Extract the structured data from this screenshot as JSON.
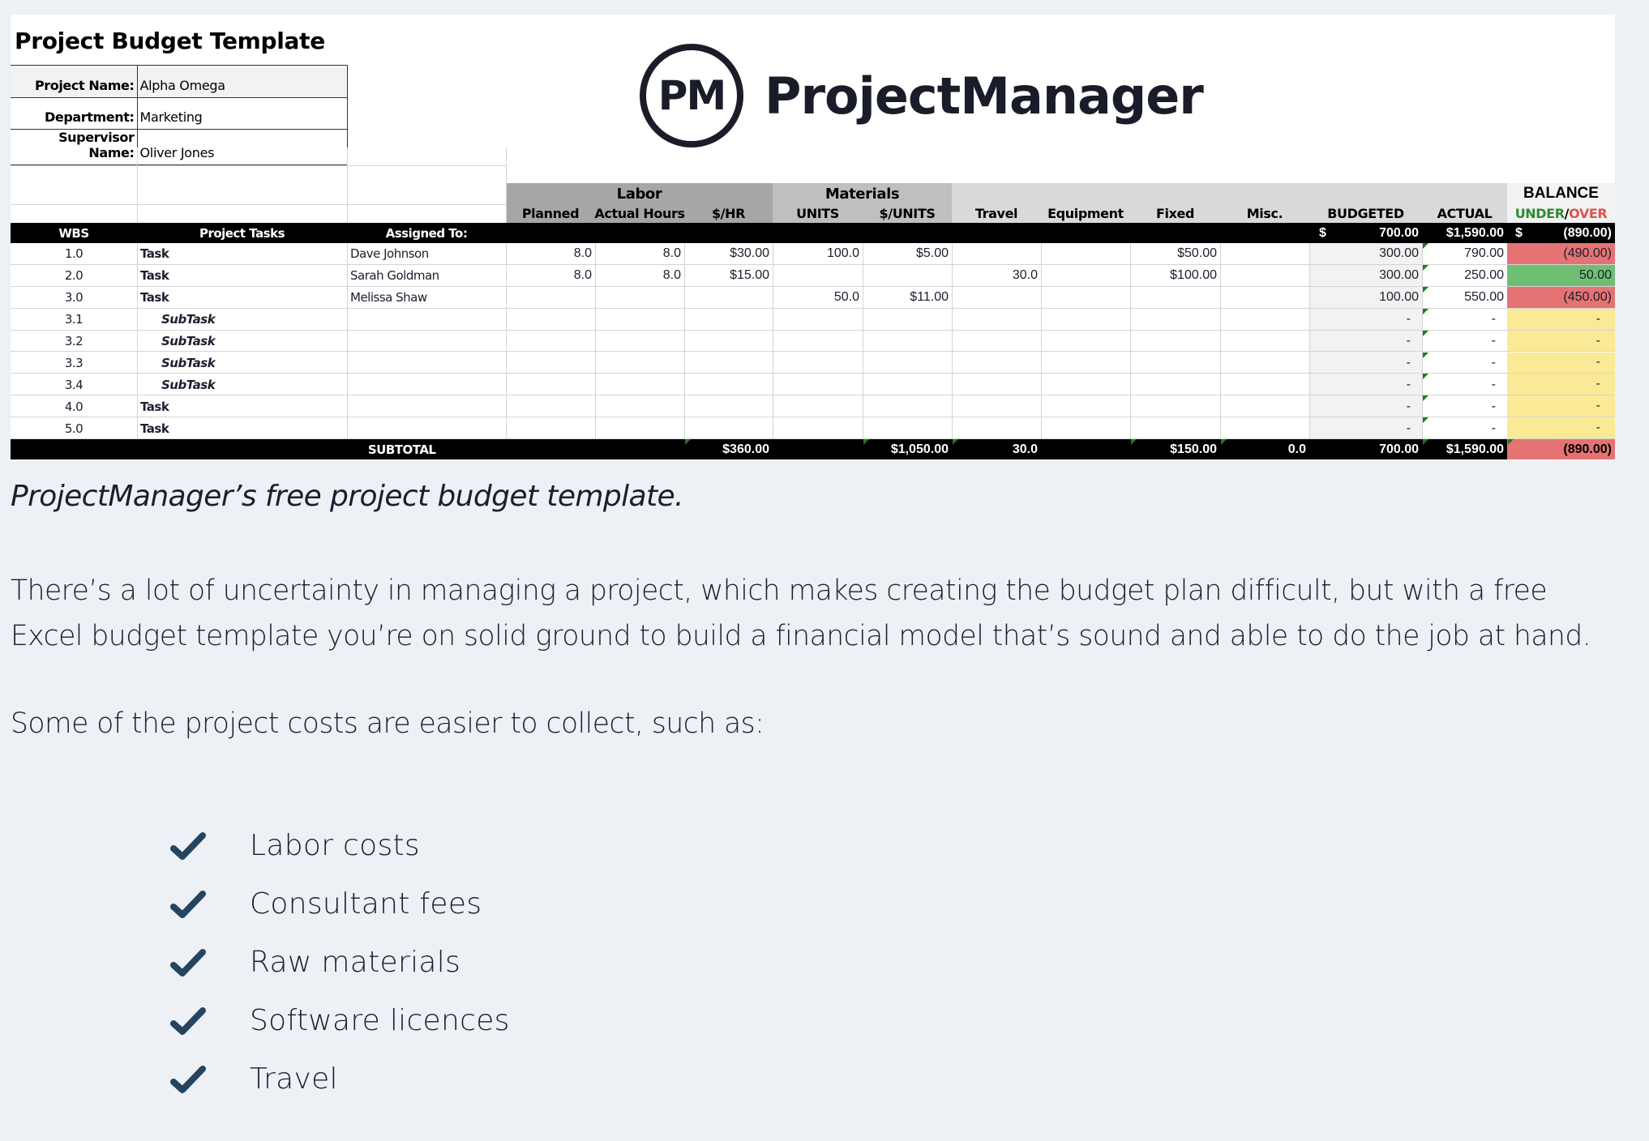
{
  "sheet": {
    "title": "Project Budget Template",
    "info": [
      {
        "label": "Project Name:",
        "value": "Alpha Omega"
      },
      {
        "label": "Department:",
        "value": "Marketing"
      },
      {
        "label": "Supervisor Name:",
        "value": "Oliver Jones"
      }
    ],
    "logo": {
      "mark": "PM",
      "name": "ProjectManager"
    },
    "group_headers": {
      "labor": "Labor",
      "materials": "Materials",
      "balance": "BALANCE",
      "balance_under": "UNDER",
      "balance_slash": "/",
      "balance_over": "OVER"
    },
    "columns": {
      "wbs": "WBS",
      "tasks": "Project Tasks",
      "assigned": "Assigned To:",
      "planned": "Planned",
      "actual_hours": "Actual Hours",
      "rate": "$/HR",
      "units": "UNITS",
      "per_unit": "$/UNITS",
      "travel": "Travel",
      "equipment": "Equipment",
      "fixed": "Fixed",
      "misc": "Misc.",
      "budgeted": "BUDGETED",
      "actual": "ACTUAL"
    },
    "totals_row": {
      "budgeted_symbol": "$",
      "budgeted": "700.00",
      "actual": "$1,590.00",
      "balance_symbol": "$",
      "balance": "(890.00)"
    },
    "rows": [
      {
        "wbs": "1.0",
        "task": "Task",
        "subtask": false,
        "assigned": "Dave Johnson",
        "planned": "8.0",
        "actual_hours": "8.0",
        "rate": "$30.00",
        "units": "100.0",
        "per_unit": "$5.00",
        "travel": "",
        "equipment": "",
        "fixed": "$50.00",
        "misc": "",
        "budgeted": "300.00",
        "actual": "790.00",
        "balance": "(490.00)",
        "status": "over"
      },
      {
        "wbs": "2.0",
        "task": "Task",
        "subtask": false,
        "assigned": "Sarah Goldman",
        "planned": "8.0",
        "actual_hours": "8.0",
        "rate": "$15.00",
        "units": "",
        "per_unit": "",
        "travel": "30.0",
        "equipment": "",
        "fixed": "$100.00",
        "misc": "",
        "budgeted": "300.00",
        "actual": "250.00",
        "balance": "50.00",
        "status": "under"
      },
      {
        "wbs": "3.0",
        "task": "Task",
        "subtask": false,
        "assigned": "Melissa Shaw",
        "planned": "",
        "actual_hours": "",
        "rate": "",
        "units": "50.0",
        "per_unit": "$11.00",
        "travel": "",
        "equipment": "",
        "fixed": "",
        "misc": "",
        "budgeted": "100.00",
        "actual": "550.00",
        "balance": "(450.00)",
        "status": "over"
      },
      {
        "wbs": "3.1",
        "task": "SubTask",
        "subtask": true,
        "assigned": "",
        "planned": "",
        "actual_hours": "",
        "rate": "",
        "units": "",
        "per_unit": "",
        "travel": "",
        "equipment": "",
        "fixed": "",
        "misc": "",
        "budgeted": "-",
        "actual": "-",
        "balance": "-",
        "status": "zero"
      },
      {
        "wbs": "3.2",
        "task": "SubTask",
        "subtask": true,
        "assigned": "",
        "planned": "",
        "actual_hours": "",
        "rate": "",
        "units": "",
        "per_unit": "",
        "travel": "",
        "equipment": "",
        "fixed": "",
        "misc": "",
        "budgeted": "-",
        "actual": "-",
        "balance": "-",
        "status": "zero"
      },
      {
        "wbs": "3.3",
        "task": "SubTask",
        "subtask": true,
        "assigned": "",
        "planned": "",
        "actual_hours": "",
        "rate": "",
        "units": "",
        "per_unit": "",
        "travel": "",
        "equipment": "",
        "fixed": "",
        "misc": "",
        "budgeted": "-",
        "actual": "-",
        "balance": "-",
        "status": "zero"
      },
      {
        "wbs": "3.4",
        "task": "SubTask",
        "subtask": true,
        "assigned": "",
        "planned": "",
        "actual_hours": "",
        "rate": "",
        "units": "",
        "per_unit": "",
        "travel": "",
        "equipment": "",
        "fixed": "",
        "misc": "",
        "budgeted": "-",
        "actual": "-",
        "balance": "-",
        "status": "zero"
      },
      {
        "wbs": "4.0",
        "task": "Task",
        "subtask": false,
        "assigned": "",
        "planned": "",
        "actual_hours": "",
        "rate": "",
        "units": "",
        "per_unit": "",
        "travel": "",
        "equipment": "",
        "fixed": "",
        "misc": "",
        "budgeted": "-",
        "actual": "-",
        "balance": "-",
        "status": "zero"
      },
      {
        "wbs": "5.0",
        "task": "Task",
        "subtask": false,
        "assigned": "",
        "planned": "",
        "actual_hours": "",
        "rate": "",
        "units": "",
        "per_unit": "",
        "travel": "",
        "equipment": "",
        "fixed": "",
        "misc": "",
        "budgeted": "-",
        "actual": "-",
        "balance": "-",
        "status": "zero"
      }
    ],
    "subtotal": {
      "label": "SUBTOTAL",
      "rate": "$360.00",
      "per_unit": "$1,050.00",
      "travel": "30.0",
      "fixed": "$150.00",
      "misc": "0.0",
      "budgeted": "700.00",
      "actual": "$1,590.00",
      "balance": "(890.00)"
    },
    "colors": {
      "over": "#e57373",
      "under": "#6fbf73",
      "zero": "#faea96",
      "under_text": "#2e8b2e",
      "over_text": "#d9534f"
    }
  },
  "article": {
    "caption": "ProjectManager’s free project budget template.",
    "paragraph1_line1": "There’s a lot of uncertainty in managing a project, which makes creating the budget plan difficult, but with a free",
    "paragraph1_line2": "Excel budget template you’re on solid ground to build a financial model that’s sound and able to do the job at hand.",
    "paragraph2": "Some of the project costs are easier to collect, such as:",
    "list_icon": "check-icon",
    "list": [
      "Labor costs",
      "Consultant fees",
      "Raw materials",
      "Software licences",
      "Travel"
    ]
  }
}
